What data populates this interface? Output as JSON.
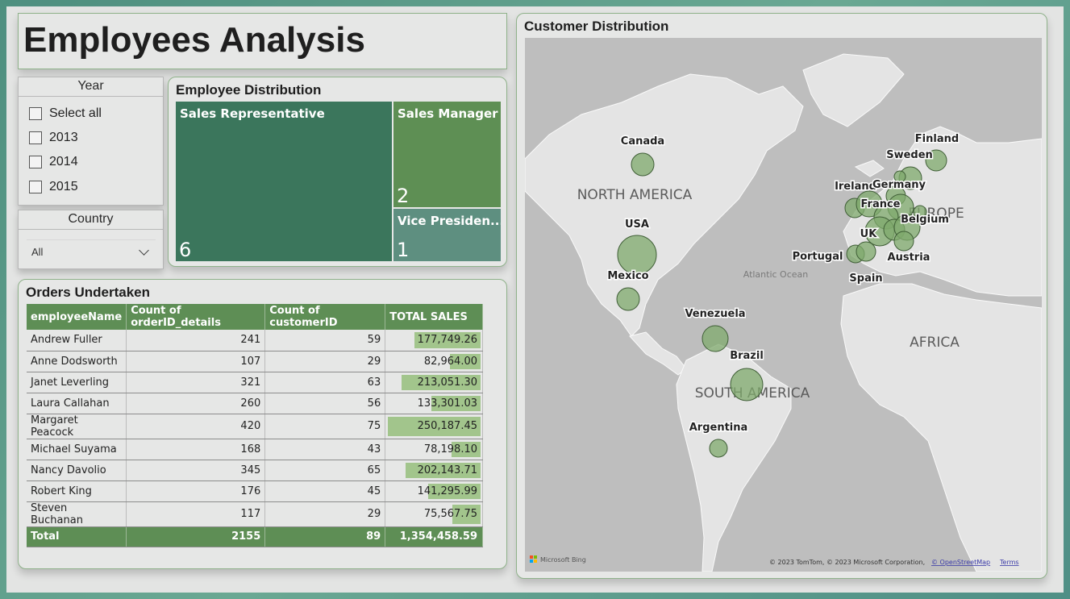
{
  "title": "Employees Analysis",
  "year_slicer": {
    "header": "Year",
    "options": [
      "Select all",
      "2013",
      "2014",
      "2015"
    ]
  },
  "country_slicer": {
    "header": "Country",
    "value": "All"
  },
  "employee_distribution": {
    "title": "Employee Distribution",
    "tiles": [
      {
        "label": "Sales Representative",
        "value": "6"
      },
      {
        "label": "Sales Manager",
        "value": "2"
      },
      {
        "label": "Vice Presiden...",
        "value": "1"
      }
    ]
  },
  "orders": {
    "title": "Orders Undertaken",
    "columns": [
      "employeeName",
      "Count of orderID_details",
      "Count of customerID",
      "TOTAL SALES"
    ],
    "rows": [
      {
        "name": "Andrew Fuller",
        "orders": "241",
        "customers": "59",
        "sales": "177,749.26",
        "sales_value": 177749.26
      },
      {
        "name": "Anne Dodsworth",
        "orders": "107",
        "customers": "29",
        "sales": "82,964.00",
        "sales_value": 82964.0
      },
      {
        "name": "Janet Leverling",
        "orders": "321",
        "customers": "63",
        "sales": "213,051.30",
        "sales_value": 213051.3
      },
      {
        "name": "Laura Callahan",
        "orders": "260",
        "customers": "56",
        "sales": "133,301.03",
        "sales_value": 133301.03
      },
      {
        "name": "Margaret Peacock",
        "orders": "420",
        "customers": "75",
        "sales": "250,187.45",
        "sales_value": 250187.45
      },
      {
        "name": "Michael Suyama",
        "orders": "168",
        "customers": "43",
        "sales": "78,198.10",
        "sales_value": 78198.1
      },
      {
        "name": "Nancy Davolio",
        "orders": "345",
        "customers": "65",
        "sales": "202,143.71",
        "sales_value": 202143.71
      },
      {
        "name": "Robert King",
        "orders": "176",
        "customers": "45",
        "sales": "141,295.99",
        "sales_value": 141295.99
      },
      {
        "name": "Steven Buchanan",
        "orders": "117",
        "customers": "29",
        "sales": "75,567.75",
        "sales_value": 75567.75
      }
    ],
    "total": {
      "label": "Total",
      "orders": "2155",
      "customers": "89",
      "sales": "1,354,458.59"
    }
  },
  "customer_distribution": {
    "title": "Customer Distribution",
    "continent_labels": [
      "NORTH AMERICA",
      "SOUTH AMERICA",
      "EUROPE",
      "AFRICA"
    ],
    "ocean_label": "Atlantic Ocean",
    "country_labels": [
      "Canada",
      "USA",
      "Mexico",
      "Venezuela",
      "Brazil",
      "Argentina",
      "Finland",
      "Sweden",
      "Ireland",
      "Germany",
      "France",
      "Belgium",
      "UK",
      "Portugal",
      "Spain",
      "Austria"
    ],
    "logo_text": "Microsoft Bing",
    "copyright": "© 2023 TomTom, © 2023 Microsoft Corporation,",
    "osm_link": "© OpenStreetMap",
    "terms_link": "Terms",
    "bubble_color": "#7faa6c"
  },
  "colors": {
    "tile_dark": "#3b765c",
    "tile_mid": "#5e8f54",
    "tile_teal": "#5e8f80",
    "table_header": "#5e8e55",
    "sales_bar": "#a2c58c"
  }
}
